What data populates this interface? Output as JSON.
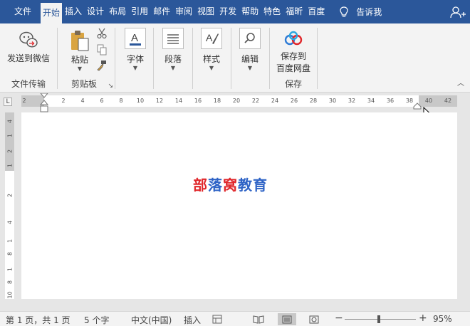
{
  "tabs": [
    {
      "label": "文件",
      "active": false
    },
    {
      "label": "开始",
      "active": true
    },
    {
      "label": "插入",
      "active": false
    },
    {
      "label": "设计",
      "active": false
    },
    {
      "label": "布局",
      "active": false
    },
    {
      "label": "引用",
      "active": false
    },
    {
      "label": "邮件",
      "active": false
    },
    {
      "label": "审阅",
      "active": false
    },
    {
      "label": "视图",
      "active": false
    },
    {
      "label": "开发",
      "active": false
    },
    {
      "label": "帮助",
      "active": false
    },
    {
      "label": "特色",
      "active": false
    },
    {
      "label": "福昕",
      "active": false
    },
    {
      "label": "百度",
      "active": false
    }
  ],
  "tell_me": "告诉我",
  "ribbon": {
    "wechat_label": "发送到微信",
    "group_file_transfer": "文件传输",
    "paste_label": "粘贴",
    "group_clipboard": "剪贴板",
    "font_label": "字体",
    "paragraph_label": "段落",
    "styles_label": "样式",
    "editing_label": "编辑",
    "baidu_line1": "保存到",
    "baidu_line2": "百度网盘",
    "group_save": "保存"
  },
  "ruler": {
    "left_ticks": [
      "2"
    ],
    "ticks": [
      "2",
      "4",
      "6",
      "8",
      "10",
      "12",
      "14",
      "16",
      "18",
      "20",
      "22",
      "24",
      "26",
      "28",
      "30",
      "32",
      "34",
      "36",
      "38",
      "40",
      "42"
    ],
    "vertical_ticks": [
      "4",
      "1",
      "2",
      "1",
      "2",
      "4",
      "1",
      "8",
      "1",
      "8",
      "10"
    ]
  },
  "document": {
    "chars": [
      "部",
      "落",
      "窝",
      "教",
      "育"
    ]
  },
  "status": {
    "page": "第 1 页，共 1 页",
    "words": "5 个字",
    "language": "中文(中国)",
    "mode": "插入",
    "zoom_minus": "−",
    "zoom_plus": "+",
    "zoom": "95%",
    "zoom_fraction": 0.48
  },
  "colors": {
    "tabbar": "#2b579a",
    "red_text": "#e0262a",
    "blue_text": "#2e63c6"
  }
}
